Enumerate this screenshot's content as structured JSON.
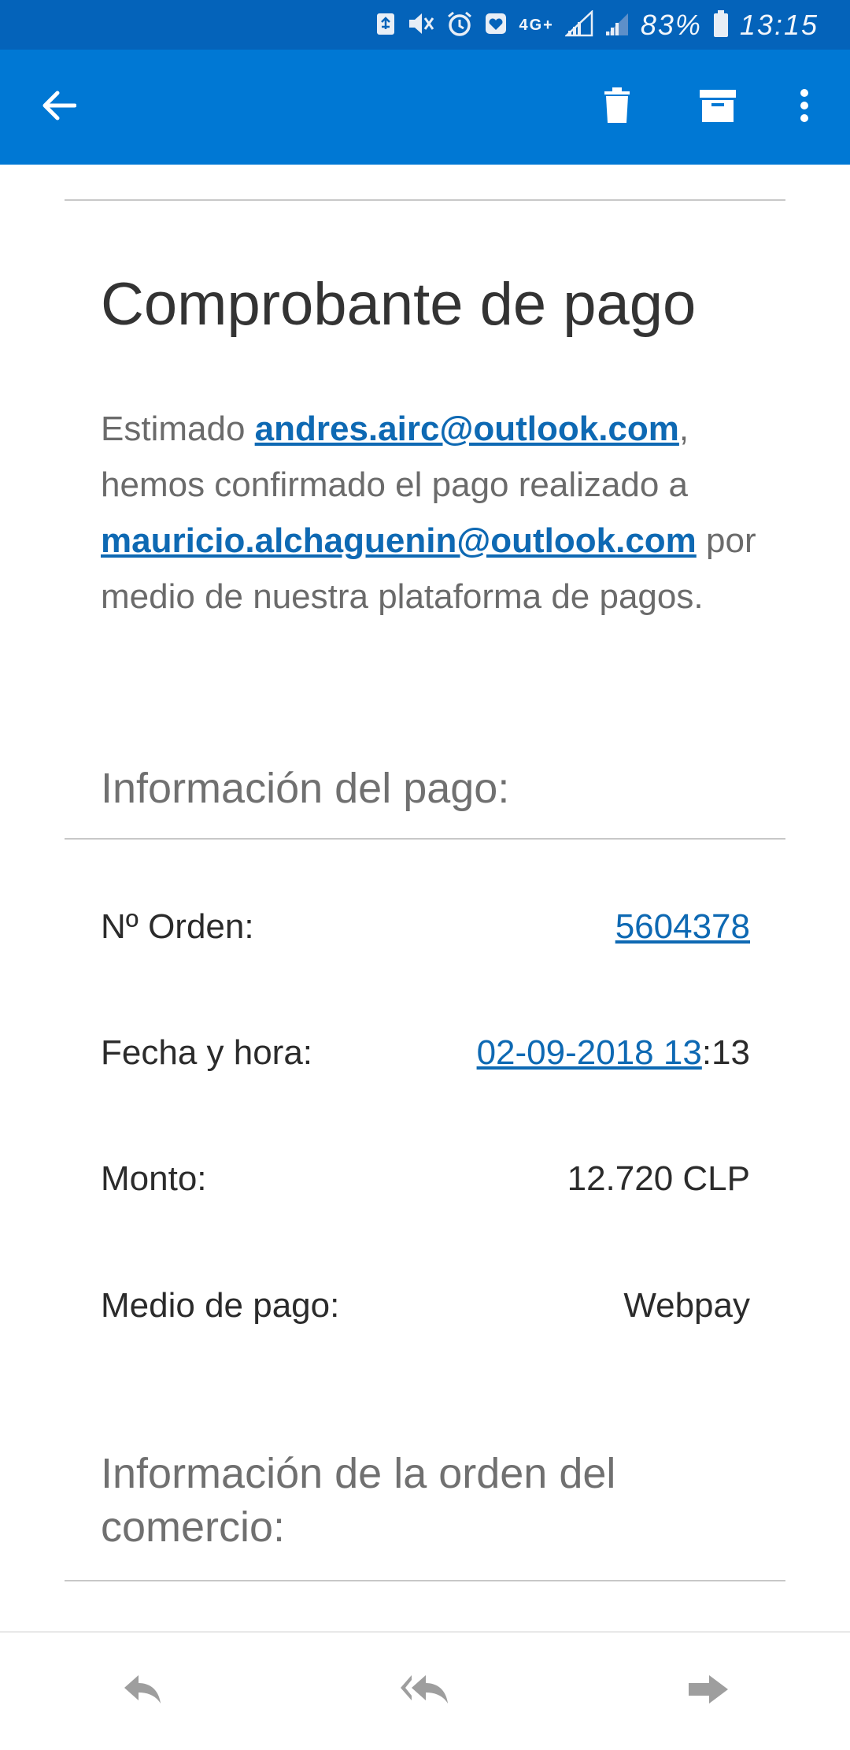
{
  "status_bar": {
    "network": "4G+",
    "battery": "83%",
    "time": "13:15"
  },
  "app_bar": {
    "icons": [
      "back-arrow-icon",
      "trash-icon",
      "archive-icon",
      "more-vertical-icon"
    ]
  },
  "email": {
    "title": "Comprobante de pago",
    "intro": {
      "greeting": "Estimado ",
      "sender_email": "andres.airc@outlook.com",
      "after_sender": ",",
      "middle": " hemos confirmado el pago realizado a ",
      "recipient_email": "mauricio.alchaguenin@outlook.com",
      "closing": " por medio de nuestra plataforma de pagos."
    },
    "payment_info": {
      "heading": "Información del pago:",
      "rows": [
        {
          "label": "Nº Orden:",
          "link": "5604378",
          "suffix": ""
        },
        {
          "label": "Fecha y hora:",
          "link": "02-09-2018 13",
          "suffix": ":13"
        },
        {
          "label": "Monto:",
          "link": "",
          "suffix": "12.720 CLP"
        },
        {
          "label": "Medio de pago:",
          "link": "",
          "suffix": "Webpay"
        }
      ]
    },
    "order_info": {
      "heading": "Información de la orden del comercio:"
    }
  },
  "bottom_bar": {
    "icons": [
      "reply-icon",
      "reply-all-icon",
      "forward-icon"
    ]
  },
  "colors": {
    "status_bar": "#0463ba",
    "app_bar": "#0078d4",
    "link": "#0e69b3",
    "divider": "#c8c8c8"
  }
}
